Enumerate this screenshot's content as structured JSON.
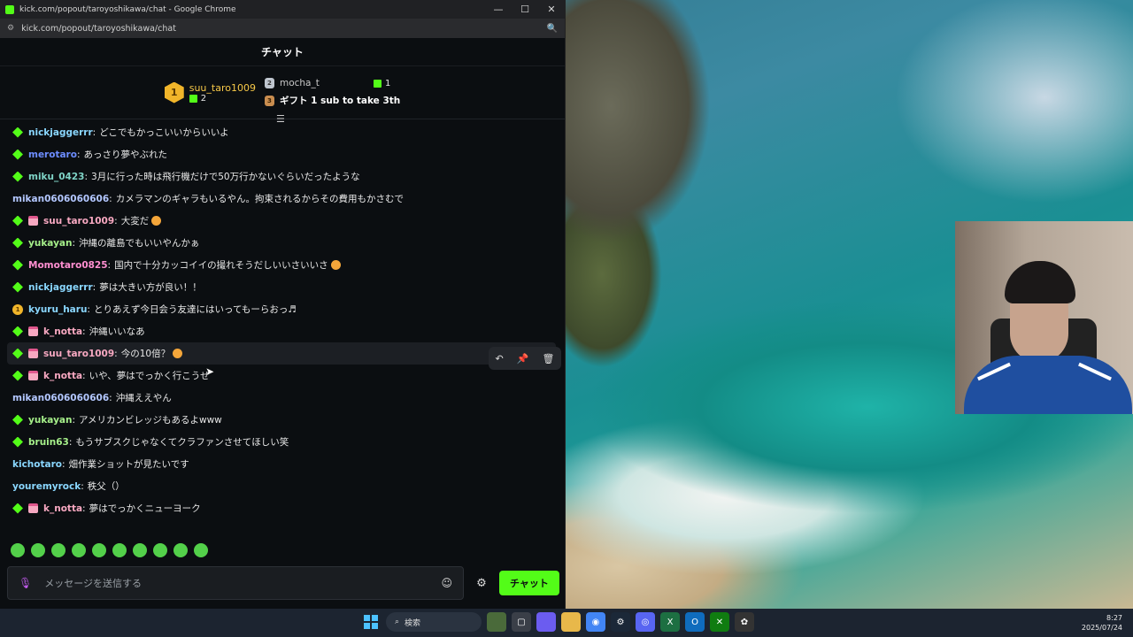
{
  "window": {
    "title": "kick.com/popout/taroyoshikawa/chat - Google Chrome",
    "url": "kick.com/popout/taroyoshikawa/chat",
    "controls": {
      "minimize": "—",
      "maximize": "☐",
      "close": "✕"
    }
  },
  "chat": {
    "title": "チャット",
    "leaderboard": {
      "first": {
        "rank": "1",
        "name": "suu_taro1009",
        "count": "2"
      },
      "second": {
        "rank": "2",
        "name": "mocha_t",
        "count": "1"
      },
      "third": {
        "rank": "3",
        "text": "ギフト 1 sub to take 3th"
      }
    },
    "messages": [
      {
        "badges": [
          "diamond"
        ],
        "user": "nickjaggerrr",
        "color": "#8ad7ff",
        "text": "どこでもかっこいいからいいよ"
      },
      {
        "badges": [
          "diamond"
        ],
        "user": "merotaro",
        "color": "#6d8dff",
        "text": "あっさり夢やぶれた"
      },
      {
        "badges": [
          "diamond"
        ],
        "user": "miku_0423",
        "color": "#7fd4c7",
        "text": "3月に行った時は飛行機だけで50万行かないぐらいだったような"
      },
      {
        "badges": [],
        "user": "mikan0606060606",
        "color": "#b3c7ff",
        "text": "カメラマンのギャラもいるやん。拘束されるからその費用もかさむで"
      },
      {
        "badges": [
          "diamond",
          "gift"
        ],
        "user": "suu_taro1009",
        "color": "#f7a8c1",
        "text": "大変だ",
        "emote": true
      },
      {
        "badges": [
          "diamond"
        ],
        "user": "yukayan",
        "color": "#a6f08a",
        "text": "沖縄の離島でもいいやんかぁ"
      },
      {
        "badges": [
          "diamond"
        ],
        "user": "Momotaro0825",
        "color": "#ff8fd1",
        "text": "国内で十分カッコイイの撮れそうだしいいさいいさ",
        "emote": true
      },
      {
        "badges": [
          "diamond"
        ],
        "user": "nickjaggerrr",
        "color": "#8ad7ff",
        "text": "夢は大きい方が良い！！"
      },
      {
        "badges": [
          "gold"
        ],
        "user": "kyuru_haru",
        "color": "#8ad7ff",
        "text": "とりあえず今日会う友達にはいってもーらおっ♬"
      },
      {
        "badges": [
          "diamond",
          "gift"
        ],
        "user": "k_notta",
        "color": "#f7a8c1",
        "text": "沖縄いいなあ"
      },
      {
        "badges": [
          "diamond",
          "gift"
        ],
        "user": "suu_taro1009",
        "color": "#f7a8c1",
        "text": "今の10倍？",
        "emote": true,
        "hover": true
      },
      {
        "badges": [
          "diamond",
          "gift"
        ],
        "user": "k_notta",
        "color": "#f7a8c1",
        "text": "いや、夢はでっかく行こうぜ"
      },
      {
        "badges": [],
        "user": "mikan0606060606",
        "color": "#b3c7ff",
        "text": "沖縄ええやん"
      },
      {
        "badges": [
          "diamond"
        ],
        "user": "yukayan",
        "color": "#a6f08a",
        "text": "アメリカンビレッジもあるよwww"
      },
      {
        "badges": [
          "diamond"
        ],
        "user": "bruin63",
        "color": "#a6f08a",
        "text": "もうサブスクじゃなくてクラファンさせてほしい笑"
      },
      {
        "badges": [],
        "user": "kichotaro",
        "color": "#8ad7ff",
        "text": "畑作業ショットが見たいです"
      },
      {
        "badges": [],
        "user": "youremyrock",
        "color": "#8ad7ff",
        "text": "秩父（）"
      },
      {
        "badges": [
          "diamond",
          "gift"
        ],
        "user": "k_notta",
        "color": "#f7a8c1",
        "text": "夢はでっかくニューヨーク"
      }
    ],
    "input": {
      "placeholder": "メッセージを送信する"
    },
    "send_label": "チャット",
    "actions": {
      "reply": "↶",
      "pin": "📌",
      "delete": "🗑"
    }
  },
  "taskbar": {
    "search": "検索",
    "time": "8:27",
    "date": "2025/07/24"
  },
  "colors": {
    "accent": "#53fc18",
    "background": "#0b0e11"
  }
}
